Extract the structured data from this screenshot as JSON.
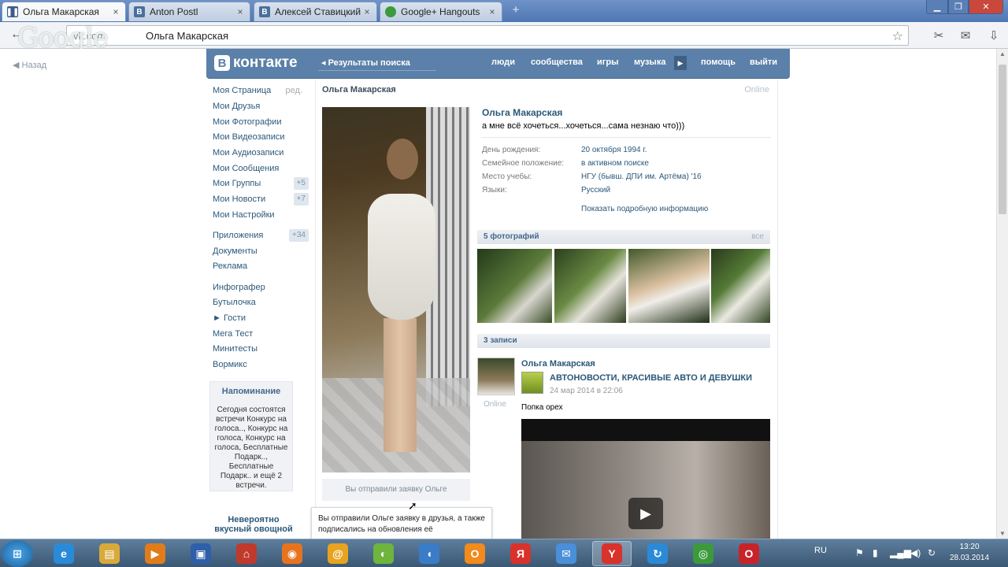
{
  "browser": {
    "tabs": [
      {
        "label": "Ольга Макарская",
        "favicon": "pause-icon",
        "active": true
      },
      {
        "label": "Anton Postl",
        "favicon": "B",
        "active": false
      },
      {
        "label": "Алексей Ставицкий",
        "favicon": "B",
        "active": false
      },
      {
        "label": "Google+ Hangouts",
        "favicon": "hangouts-icon",
        "active": false
      }
    ],
    "url_host": "vk.com",
    "url_path": "Ольга Макарская",
    "watermark": "Google"
  },
  "vk": {
    "back_link": "Назад",
    "logo_text": "контакте",
    "search_results": "Результаты поиска",
    "nav": [
      "люди",
      "сообщества",
      "игры",
      "музыка",
      "помощь",
      "выйти"
    ],
    "menu": [
      {
        "label": "Моя Страница",
        "extra": "ред."
      },
      {
        "label": "Мои Друзья"
      },
      {
        "label": "Мои Фотографии"
      },
      {
        "label": "Мои Видеозаписи"
      },
      {
        "label": "Мои Аудиозаписи"
      },
      {
        "label": "Мои Сообщения"
      },
      {
        "label": "Мои Группы",
        "count": "+5"
      },
      {
        "label": "Мои Новости",
        "count": "+7"
      },
      {
        "label": "Мои Настройки"
      },
      {
        "label": "Приложения",
        "count": "+34"
      },
      {
        "label": "Документы"
      },
      {
        "label": "Реклама"
      },
      {
        "label": "Инфографер"
      },
      {
        "label": "Бутылочка"
      },
      {
        "label": "► Гости"
      },
      {
        "label": "Мега Тест"
      },
      {
        "label": "Минитесты"
      },
      {
        "label": "Вормикс"
      }
    ],
    "reminder": {
      "title": "Напоминание",
      "text": "Сегодня состоятся встречи Конкурс на голоса.., Конкурс на голоса, Конкурс на голоса, Бесплатные Подарк.., Бесплатные Подарк.. и ещё 2 встречи."
    },
    "ad_title": "Невероятно вкусный овощной"
  },
  "profile": {
    "name_top": "Ольга Макарская",
    "online_top": "Online",
    "name": "Ольга Макарская",
    "status": "а мне всё хочеться...хочеться...сама незнаю что)))",
    "info": [
      {
        "key": "День рождения:",
        "value": "20 октября 1994 г."
      },
      {
        "key": "Семейное положение:",
        "value": "в активном поиске"
      },
      {
        "key": "Место учебы:",
        "value": "НГУ (бывш. ДПИ им. Артёма) '16"
      },
      {
        "key": "Языки:",
        "value": "Русский"
      }
    ],
    "show_more": "Показать подробную информацию",
    "photos_header": "5 фотографий",
    "photos_header_right": "все",
    "posts_header": "3 записи",
    "request_button": "Вы отправили заявку Ольге",
    "tooltip": "Вы отправили Ольге заявку в друзья, а также подписались на обновления её",
    "post": {
      "author": "Ольга Макарская",
      "online": "Online",
      "group": "АВТОНОВОСТИ, КРАСИВЫЕ АВТО И ДЕВУШКИ",
      "date": "24 мар 2014 в 22:06",
      "text": "Попка орех"
    }
  },
  "taskbar": {
    "start": "⊞",
    "lang": "RU",
    "time": "13:20",
    "date": "28.03.2014",
    "apps": [
      {
        "name": "ie-icon",
        "glyph": "e",
        "color": "#2a8ad8"
      },
      {
        "name": "explorer-icon",
        "glyph": "▤",
        "color": "#d9a93a"
      },
      {
        "name": "media-player-icon",
        "glyph": "▶",
        "color": "#e07d1a"
      },
      {
        "name": "floppy-icon",
        "glyph": "▣",
        "color": "#2f5fa8"
      },
      {
        "name": "bank-icon",
        "glyph": "⌂",
        "color": "#c0392b"
      },
      {
        "name": "firefox-icon",
        "glyph": "◉",
        "color": "#e8731f"
      },
      {
        "name": "mail-agent-icon",
        "glyph": "@",
        "color": "#e8a31f"
      },
      {
        "name": "ball-icon",
        "glyph": "◐",
        "color": "#6fb43c"
      },
      {
        "name": "speaker-icon",
        "glyph": "◖",
        "color": "#3a7cc7"
      },
      {
        "name": "odnoklassniki-icon",
        "glyph": "О",
        "color": "#f28a1c"
      },
      {
        "name": "yandex-icon",
        "glyph": "Я",
        "color": "#d9322a"
      },
      {
        "name": "mail-icon",
        "glyph": "✉",
        "color": "#4a8fd8"
      },
      {
        "name": "yandex-browser-icon",
        "glyph": "Y",
        "color": "#d9322a"
      },
      {
        "name": "sync-icon",
        "glyph": "↻",
        "color": "#2a8ad8"
      },
      {
        "name": "chrome-icon",
        "glyph": "◎",
        "color": "#3c9a3c"
      },
      {
        "name": "opera-icon",
        "glyph": "O",
        "color": "#c9232a"
      }
    ]
  }
}
